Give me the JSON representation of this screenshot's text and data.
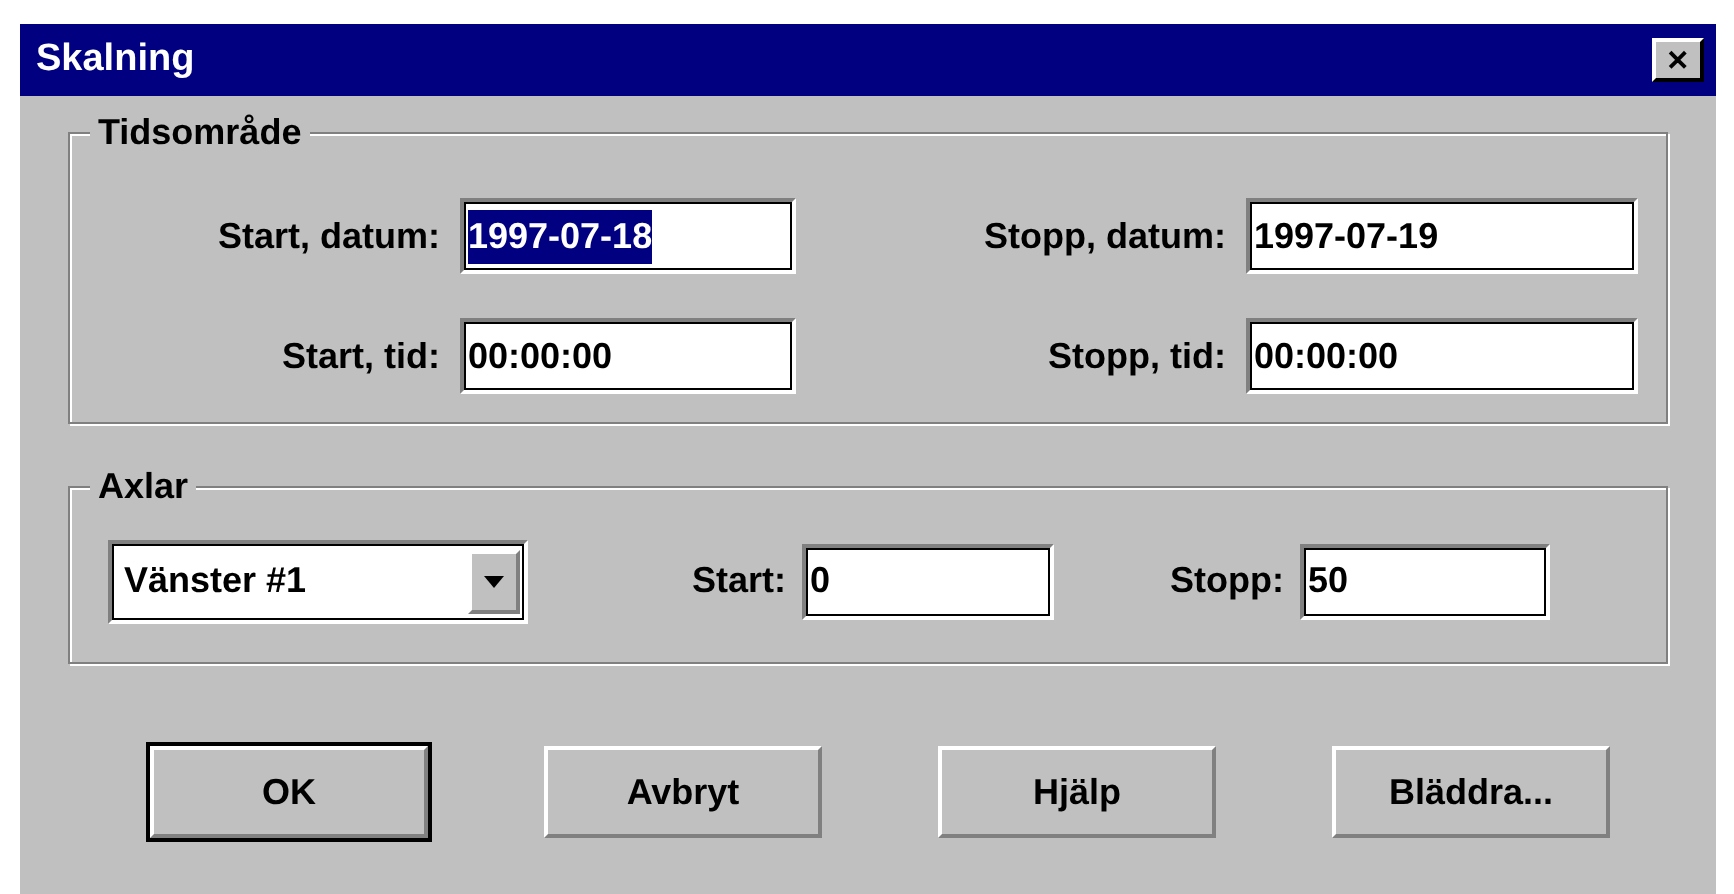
{
  "window": {
    "title": "Skalning",
    "close": "✕"
  },
  "time_range": {
    "title": "Tidsområde",
    "fields": [
      {
        "label": "Start, datum:",
        "value": "1997-07-18",
        "text_selected": true
      },
      {
        "label": "Stopp, datum:",
        "value": "1997-07-19",
        "text_selected": false
      },
      {
        "label": "Start, tid:",
        "value": "00:00:00",
        "text_selected": false
      },
      {
        "label": "Stopp, tid:",
        "value": "00:00:00",
        "text_selected": false
      }
    ]
  },
  "axes": {
    "title": "Axlar",
    "axis": "Vänster #1",
    "fields": [
      {
        "label": "Start:",
        "value": "0"
      },
      {
        "label": "Stopp:",
        "value": "50"
      }
    ]
  },
  "buttons": [
    {
      "label": "OK",
      "default": true
    },
    {
      "label": "Avbryt",
      "default": false
    },
    {
      "label": "Hjälp",
      "default": false
    },
    {
      "label": "Bläddra...",
      "default": false
    }
  ]
}
